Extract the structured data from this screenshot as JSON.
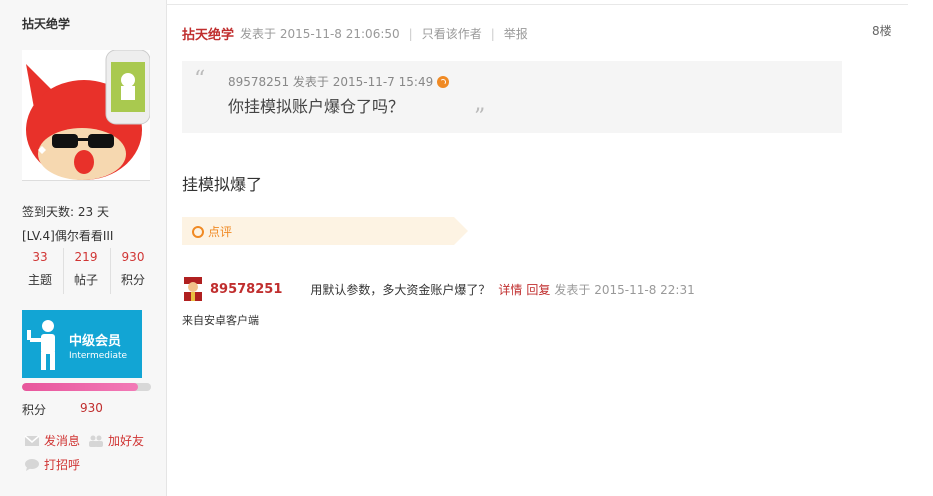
{
  "sidebar": {
    "username": "拈天绝学",
    "checkin": "签到天数: 23 天",
    "level": "[LV.4]偶尔看看III",
    "stats": [
      {
        "value": "33",
        "label": "主题"
      },
      {
        "value": "219",
        "label": "帖子"
      },
      {
        "value": "930",
        "label": "积分"
      }
    ],
    "badge": {
      "title": "中级会员",
      "subtitle": "Intermediate"
    },
    "progress": 0.9,
    "points_label": "积分",
    "points_value": "930",
    "actions": {
      "message": "发消息",
      "add_friend": "加好友",
      "greet": "打招呼"
    }
  },
  "post": {
    "author": "拈天绝学",
    "posted_at": "发表于 2015-11-8 21:06:50",
    "only_author": "只看该作者",
    "report": "举报",
    "floor": "8楼",
    "quote": {
      "meta": "89578251 发表于 2015-11-7 15:49",
      "text": "你挂模拟账户爆仓了吗？"
    },
    "body": "挂模拟爆了",
    "comment_label": "点评"
  },
  "reply": {
    "user": "89578251",
    "text": "用默认参数，多大资金账户爆了？",
    "detail": "详情",
    "reply_link": "回复",
    "time": "发表于 2015-11-8 22:31",
    "source": "来自安卓客户端"
  },
  "colors": {
    "accent_red": "#c02e2e",
    "badge_blue": "#12a5d4",
    "comment_orange": "#f08a24"
  }
}
